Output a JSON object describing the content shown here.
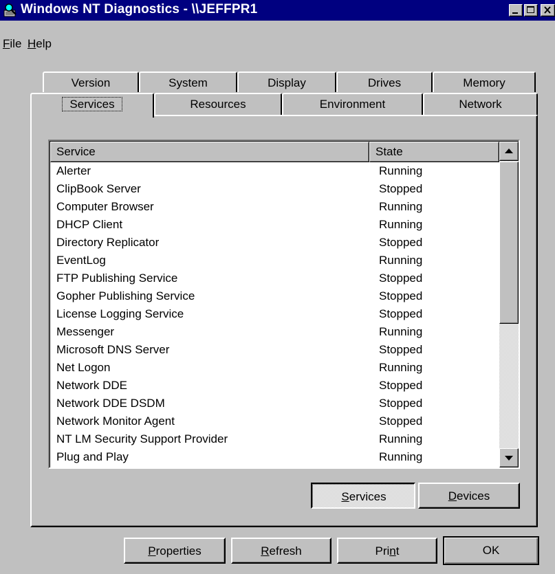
{
  "window": {
    "title": "Windows NT Diagnostics - \\\\JEFFPR1",
    "colors": {
      "titlebar": "#000080",
      "face": "#c0c0c0"
    }
  },
  "menu": {
    "file_accel": "F",
    "file_rest": "ile",
    "help_accel": "H",
    "help_rest": "elp"
  },
  "tabs": {
    "row1": [
      "Version",
      "System",
      "Display",
      "Drives",
      "Memory"
    ],
    "row2": [
      "Services",
      "Resources",
      "Environment",
      "Network"
    ],
    "active": "Services"
  },
  "list": {
    "headers": {
      "service": "Service",
      "state": "State"
    },
    "rows": [
      {
        "service": "Alerter",
        "state": "Running"
      },
      {
        "service": "ClipBook Server",
        "state": "Stopped"
      },
      {
        "service": "Computer Browser",
        "state": "Running"
      },
      {
        "service": "DHCP Client",
        "state": "Running"
      },
      {
        "service": "Directory Replicator",
        "state": "Stopped"
      },
      {
        "service": "EventLog",
        "state": "Running"
      },
      {
        "service": "FTP Publishing Service",
        "state": "Stopped"
      },
      {
        "service": "Gopher Publishing Service",
        "state": "Stopped"
      },
      {
        "service": "License Logging Service",
        "state": "Stopped"
      },
      {
        "service": "Messenger",
        "state": "Running"
      },
      {
        "service": "Microsoft DNS Server",
        "state": "Stopped"
      },
      {
        "service": "Net Logon",
        "state": "Running"
      },
      {
        "service": "Network DDE",
        "state": "Stopped"
      },
      {
        "service": "Network DDE DSDM",
        "state": "Stopped"
      },
      {
        "service": "Network Monitor Agent",
        "state": "Stopped"
      },
      {
        "service": "NT LM Security Support Provider",
        "state": "Running"
      },
      {
        "service": "Plug and Play",
        "state": "Running"
      }
    ]
  },
  "buttons": {
    "services": {
      "accel": "S",
      "rest": "ervices"
    },
    "devices": {
      "accel": "D",
      "rest": "evices"
    },
    "properties": {
      "accel": "P",
      "rest": "roperties"
    },
    "refresh": {
      "accel": "R",
      "rest": "efresh"
    },
    "print_pre": "Pri",
    "print_accel": "n",
    "print_post": "t",
    "ok": "OK"
  },
  "icons": {
    "app": "diagnostics-magnifier-icon",
    "minimize": "minimize-icon",
    "maximize": "maximize-icon",
    "close": "close-icon",
    "scroll_up": "scroll-up-arrow-icon",
    "scroll_down": "scroll-down-arrow-icon"
  }
}
